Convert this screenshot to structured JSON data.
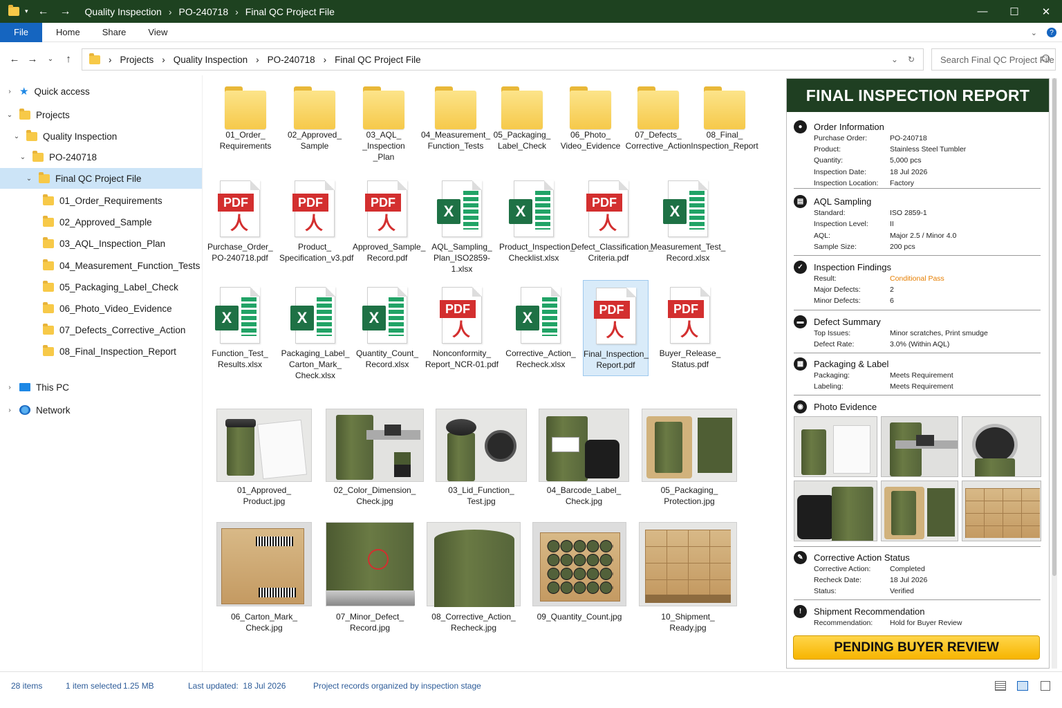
{
  "titlebar": {
    "crumbs": [
      "Quality Inspection",
      "PO-240718",
      "Final QC Project File"
    ],
    "controls": {
      "minimize": "—",
      "maximize": "☐",
      "close": "✕"
    }
  },
  "ribbon": {
    "file": "File",
    "tabs": [
      "Home",
      "Share",
      "View"
    ],
    "help": "?"
  },
  "address": {
    "crumbs": [
      "Projects",
      "Quality Inspection",
      "PO-240718",
      "Final QC Project File"
    ]
  },
  "search": {
    "placeholder": "Search Final QC Project File"
  },
  "sidebar": {
    "quick_access": "Quick access",
    "projects": "Projects",
    "quality_inspection": "Quality Inspection",
    "po": "PO-240718",
    "final_qc": "Final QC Project File",
    "subfolders": [
      "01_Order_Requirements",
      "02_Approved_Sample",
      "03_AQL_Inspection_Plan",
      "04_Measurement_Function_Tests",
      "05_Packaging_Label_Check",
      "06_Photo_Video_Evidence",
      "07_Defects_Corrective_Action",
      "08_Final_Inspection_Report"
    ],
    "this_pc": "This PC",
    "network": "Network"
  },
  "folders": [
    "01_Order_\nRequirements",
    "02_Approved_\nSample",
    "03_AQL_\n_Inspection\n_Plan",
    "04_Measurement_\nFunction_Tests",
    "05_Packaging_\nLabel_Check",
    "06_Photo_\nVideo_Evidence",
    "07_Defects_\nCorrective_Action",
    "08_Final_\nInspection_Report"
  ],
  "files_row1": [
    {
      "name": "Purchase_Order_\nPO-240718.pdf",
      "type": "pdf"
    },
    {
      "name": "Product_\nSpecification_v3.pdf",
      "type": "pdf"
    },
    {
      "name": "Approved_Sample_\nRecord.pdf",
      "type": "pdf"
    },
    {
      "name": "AQL_Sampling_\nPlan_ISO2859-1.xlsx",
      "type": "xlsx"
    },
    {
      "name": "Product_Inspection_\nChecklist.xlsx",
      "type": "xlsx"
    },
    {
      "name": "Defect_Classification_\nCriteria.pdf",
      "type": "pdf"
    },
    {
      "name": "Measurement_Test_\nRecord.xlsx",
      "type": "xlsx"
    }
  ],
  "files_row2": [
    {
      "name": "Function_Test_\nResults.xlsx",
      "type": "xlsx"
    },
    {
      "name": "Packaging_Label_\nCarton_Mark_\nCheck.xlsx",
      "type": "xlsx"
    },
    {
      "name": "Quantity_Count_\nRecord.xlsx",
      "type": "xlsx"
    },
    {
      "name": "Nonconformity_\nReport_NCR-01.pdf",
      "type": "pdf"
    },
    {
      "name": "Corrective_Action_\nRecheck.xlsx",
      "type": "xlsx"
    },
    {
      "name": "Final_Inspection_\nReport.pdf",
      "type": "pdf"
    },
    {
      "name": "Buyer_Release_\nStatus.pdf",
      "type": "pdf"
    }
  ],
  "icon_text": {
    "pdf": "PDF",
    "pdf_symbol": "人",
    "xlsx": "X"
  },
  "photos": [
    "01_Approved_\nProduct.jpg",
    "02_Color_Dimension_\nCheck.jpg",
    "03_Lid_Function_\nTest.jpg",
    "04_Barcode_Label_\nCheck.jpg",
    "05_Packaging_\nProtection.jpg",
    "06_Carton_Mark_\nCheck.jpg",
    "07_Minor_Defect_\nRecord.jpg",
    "08_Corrective_Action_\nRecheck.jpg",
    "09_Quantity_Count.jpg",
    "10_Shipment_\nReady.jpg"
  ],
  "report": {
    "title": "FINAL INSPECTION REPORT",
    "order": {
      "title": "Order Information",
      "rows": [
        [
          "Purchase Order:",
          "PO-240718"
        ],
        [
          "Product:",
          "Stainless Steel Tumbler"
        ],
        [
          "Quantity:",
          "5,000 pcs"
        ],
        [
          "Inspection Date:",
          "18 Jul 2026"
        ],
        [
          "Inspection Location:",
          "Factory"
        ]
      ]
    },
    "aql": {
      "title": "AQL Sampling",
      "rows": [
        [
          "Standard:",
          "ISO 2859-1"
        ],
        [
          "Inspection Level:",
          "II"
        ],
        [
          "AQL:",
          "Major 2.5 / Minor 4.0"
        ],
        [
          "Sample Size:",
          "200 pcs"
        ]
      ]
    },
    "findings": {
      "title": "Inspection Findings",
      "rows": [
        [
          "Result:",
          "Conditional Pass"
        ],
        [
          "Major Defects:",
          "2"
        ],
        [
          "Minor Defects:",
          "6"
        ]
      ]
    },
    "defects": {
      "title": "Defect Summary",
      "rows": [
        [
          "Top Issues:",
          "Minor scratches, Print smudge"
        ],
        [
          "Defect Rate:",
          "3.0% (Within AQL)"
        ]
      ]
    },
    "packaging": {
      "title": "Packaging & Label",
      "rows": [
        [
          "Packaging:",
          "Meets Requirement"
        ],
        [
          "Labeling:",
          "Meets Requirement"
        ]
      ]
    },
    "photo_evidence": {
      "title": "Photo Evidence"
    },
    "corrective": {
      "title": "Corrective Action Status",
      "rows": [
        [
          "Corrective Action:",
          "Completed"
        ],
        [
          "Recheck Date:",
          "18 Jul 2026"
        ],
        [
          "Status:",
          "Verified"
        ]
      ]
    },
    "shipment": {
      "title": "Shipment Recommendation",
      "rows": [
        [
          "Recommendation:",
          "Hold for Buyer Review"
        ]
      ]
    },
    "status_button": "PENDING BUYER REVIEW",
    "result_color": "#e67e00"
  },
  "statusbar": {
    "items": "28 items",
    "selected": "1 item selected",
    "size": "1.25 MB",
    "updated": "Last updated:  18 Jul 2026",
    "note": "Project records organized by inspection stage"
  },
  "colors": {
    "titlebar": "#1e4220",
    "accent": "#1565c0",
    "report_header": "#1f3f22",
    "button": "#f7b500"
  }
}
